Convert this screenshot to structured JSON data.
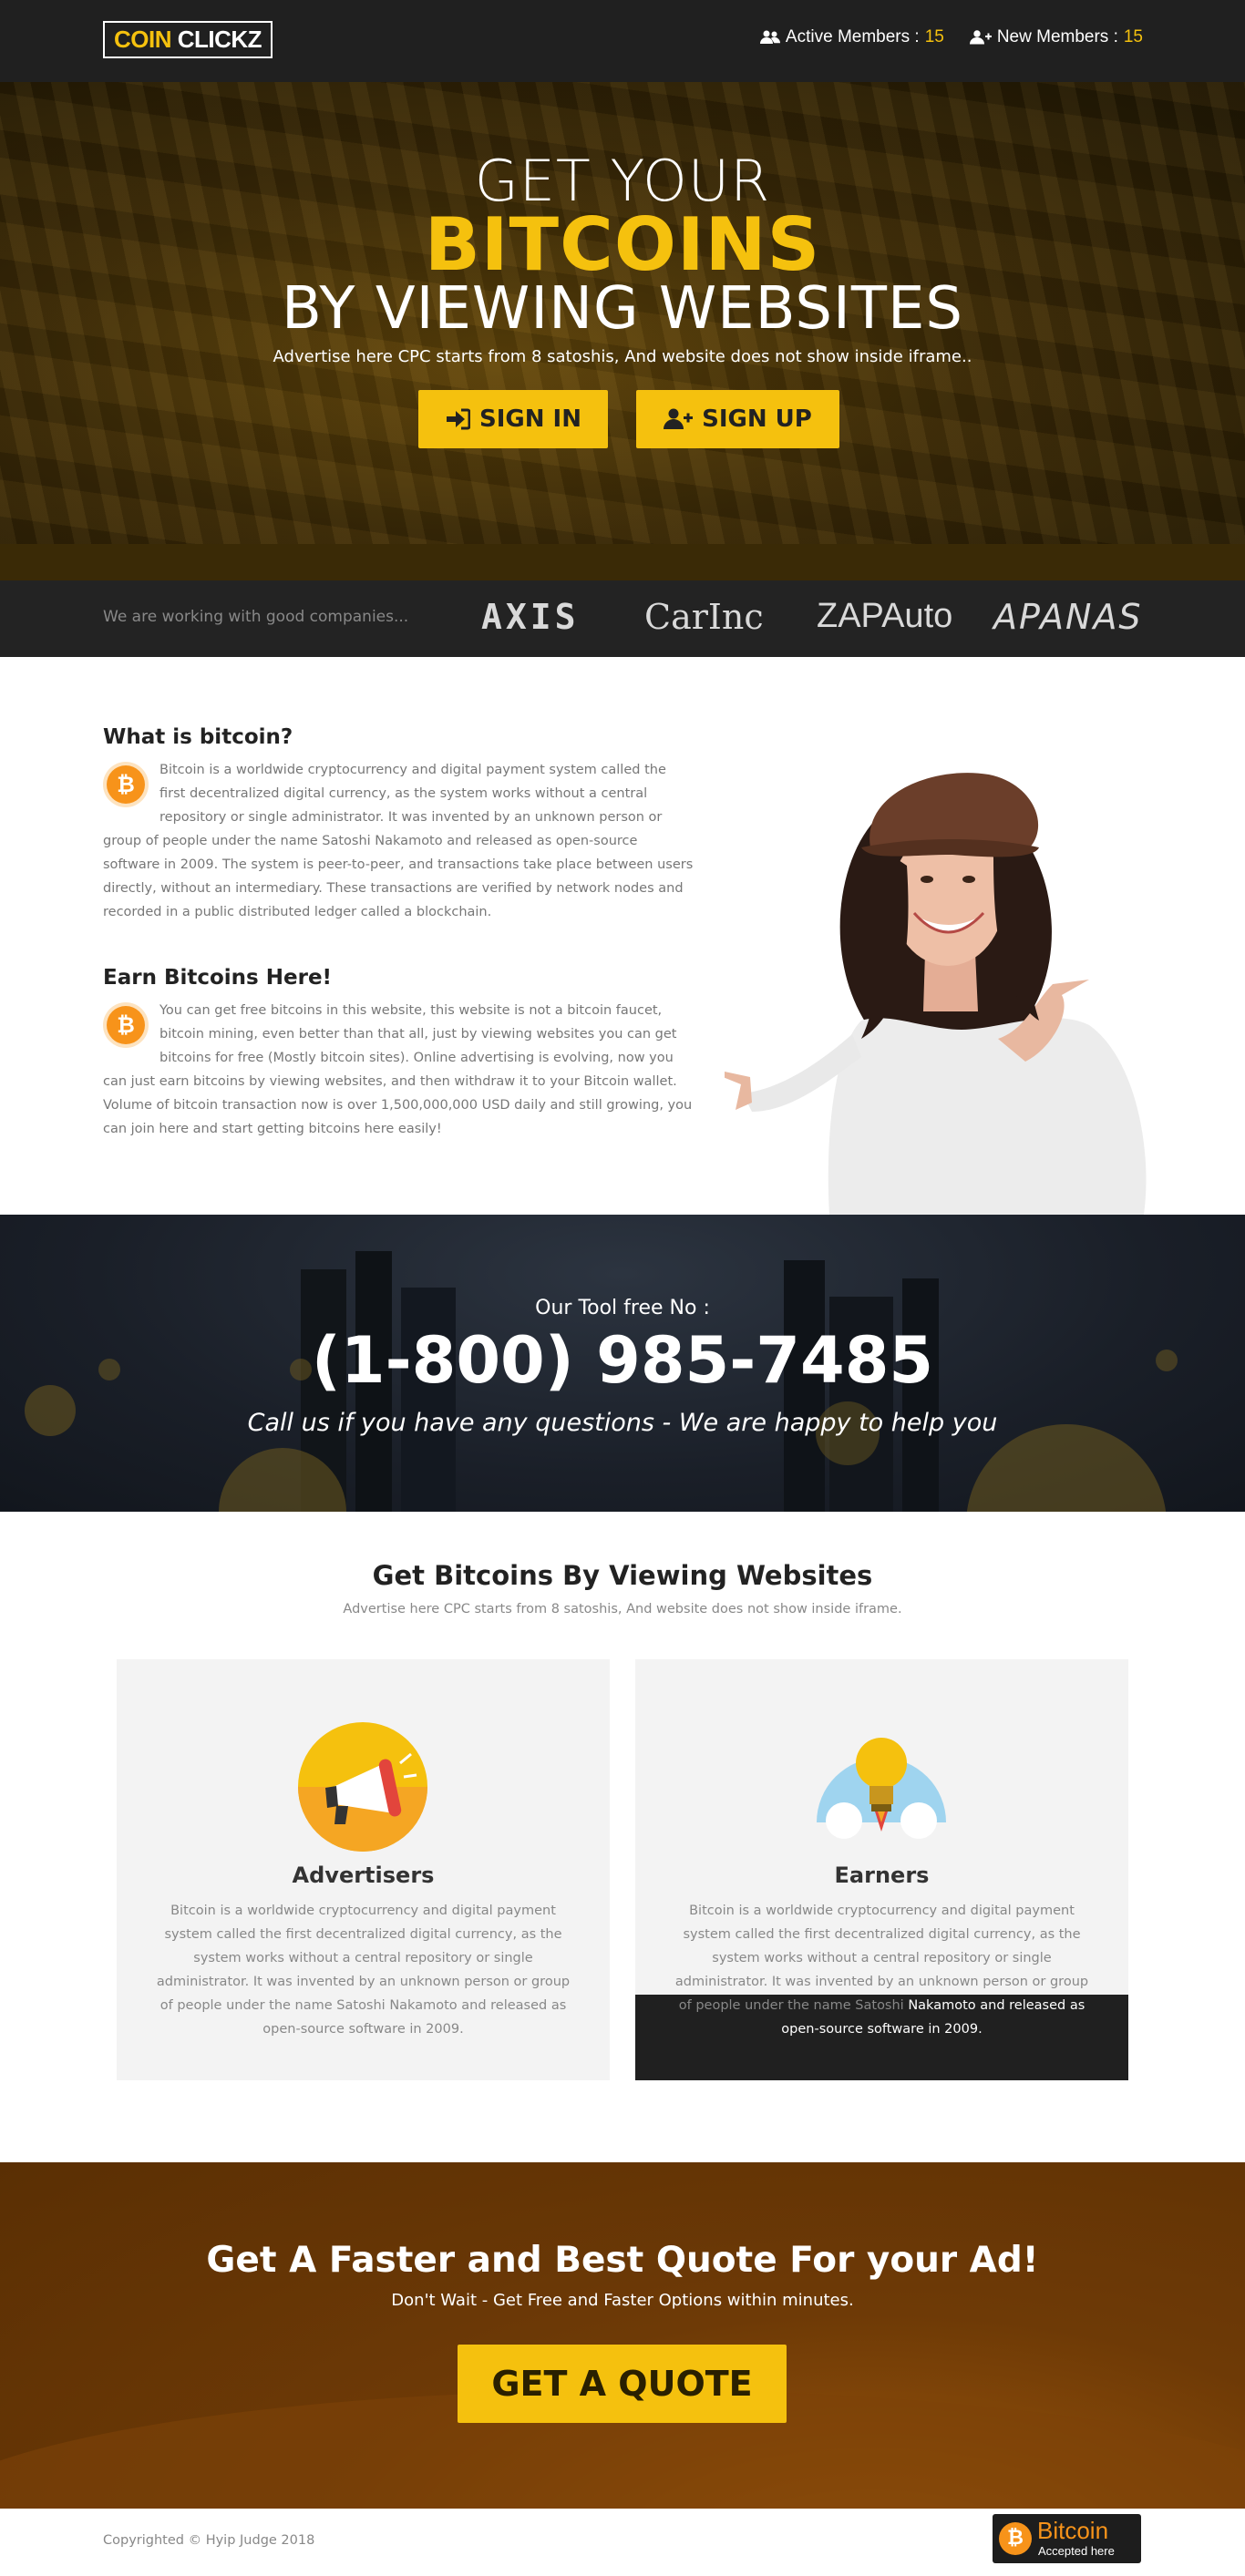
{
  "header": {
    "logo_part1": "COIN",
    "logo_part2": "CLICKZ",
    "active_label": "Active Members :",
    "active_count": "15",
    "new_label": "New Members :",
    "new_count": "15",
    "active_icon": "users-icon",
    "new_icon": "user-plus-icon"
  },
  "hero": {
    "line1": "GET YOUR",
    "line2": "BITCOINS",
    "line3": "BY VIEWING WEBSITES",
    "subtitle": "Advertise here CPC starts from 8 satoshis, And website does not show inside iframe..",
    "signin_label": "SIGN IN",
    "signup_label": "SIGN UP",
    "signin_icon": "sign-in-icon",
    "signup_icon": "user-plus-icon"
  },
  "partners": {
    "lead": "We are working with good companies...",
    "names": [
      "AXIS",
      "CarInc",
      "ZAPAuto",
      "APANAS"
    ]
  },
  "about": {
    "q1_title": "What is bitcoin?",
    "q1_text": "Bitcoin is a worldwide cryptocurrency and digital payment system called the first decentralized digital currency, as the system works without a central repository or single administrator. It was invented by an unknown person or group of people under the name Satoshi Nakamoto and released as open-source software in 2009. The system is peer-to-peer, and transactions take place between users directly, without an intermediary. These transactions are verified by network nodes and recorded in a public distributed ledger called a blockchain.",
    "q2_title": "Earn Bitcoins Here!",
    "q2_text": "You can get free bitcoins in this website, this website is not a bitcoin faucet, bitcoin mining, even better than that all, just by viewing websites you can get bitcoins for free (Mostly bitcoin sites). Online advertising is evolving, now you can just earn bitcoins by viewing websites, and then withdraw it to your Bitcoin wallet. Volume of bitcoin transaction now is over 1,500,000,000 USD daily and still growing, you can join here and start getting bitcoins here easily!",
    "coin_symbol": "₿"
  },
  "phone": {
    "label": "Our Tool free No :",
    "number": "(1-800) 985-7485",
    "subtitle": "Call us if you have any questions - We are happy to help you"
  },
  "services": {
    "title": "Get Bitcoins By Viewing Websites",
    "subtitle": "Advertise here CPC starts from 8 satoshis, And website does not show inside iframe.",
    "cards": [
      {
        "title": "Advertisers",
        "icon": "megaphone-icon",
        "text": "Bitcoin is a worldwide cryptocurrency and digital payment system called the first decentralized digital currency, as the system works without a central repository or single administrator. It was invented by an unknown person or group of people under the name Satoshi Nakamoto and released as open-source software in 2009."
      },
      {
        "title": "Earners",
        "icon": "lightbulb-rocket-icon",
        "text_top": "Bitcoin is a worldwide cryptocurrency and digital payment system called the first decentralized digital currency, as the system works without a central repository or single administrator. It was invented by an unknown person or group of people under the name Satoshi",
        "text_bottom": "Nakamoto and released as open-source software in 2009."
      }
    ]
  },
  "quote": {
    "title": "Get A Faster and Best Quote For your Ad!",
    "subtitle": "Don't Wait - Get Free and Faster Options within minutes.",
    "button": "GET A QUOTE"
  },
  "footer": {
    "copyright": "Copyrighted © Hyip Judge 2018",
    "badge_title": "Bitcoin",
    "badge_sub": "Accepted here",
    "badge_symbol": "₿"
  },
  "colors": {
    "accent": "#f5c10e",
    "dark": "#202020",
    "bitcoin_orange": "#f7931a"
  }
}
